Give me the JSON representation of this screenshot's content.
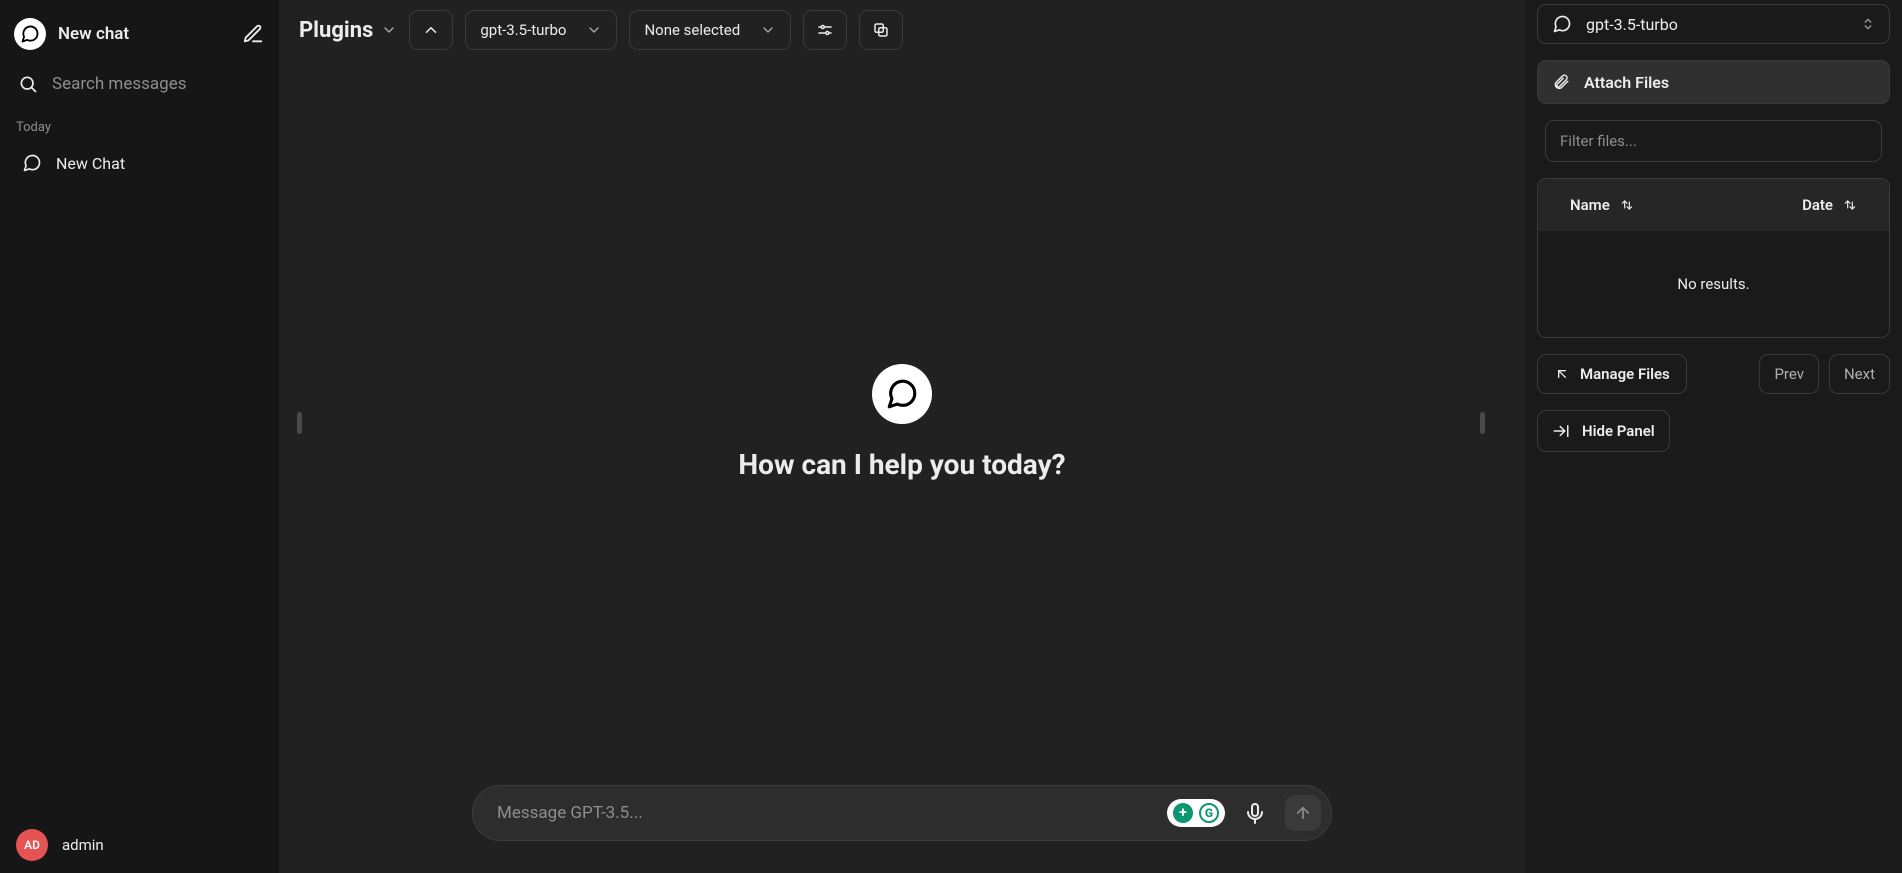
{
  "sidebar": {
    "title": "New chat",
    "search_placeholder": "Search messages",
    "sections": {
      "today_label": "Today"
    },
    "history": [
      {
        "label": "New Chat"
      }
    ],
    "user": {
      "initials": "AD",
      "name": "admin"
    }
  },
  "topbar": {
    "endpoint_label": "Plugins",
    "model_selected": "gpt-3.5-turbo",
    "plugin_selected": "None selected"
  },
  "splash": {
    "title": "How can I help you today?"
  },
  "composer": {
    "placeholder": "Message GPT-3.5..."
  },
  "rightpanel": {
    "model": "gpt-3.5-turbo",
    "attach_header": "Attach Files",
    "filter_placeholder": "Filter files...",
    "columns": {
      "name": "Name",
      "date": "Date"
    },
    "empty_text": "No results.",
    "manage_label": "Manage Files",
    "prev_label": "Prev",
    "next_label": "Next",
    "hide_label": "Hide Panel"
  }
}
